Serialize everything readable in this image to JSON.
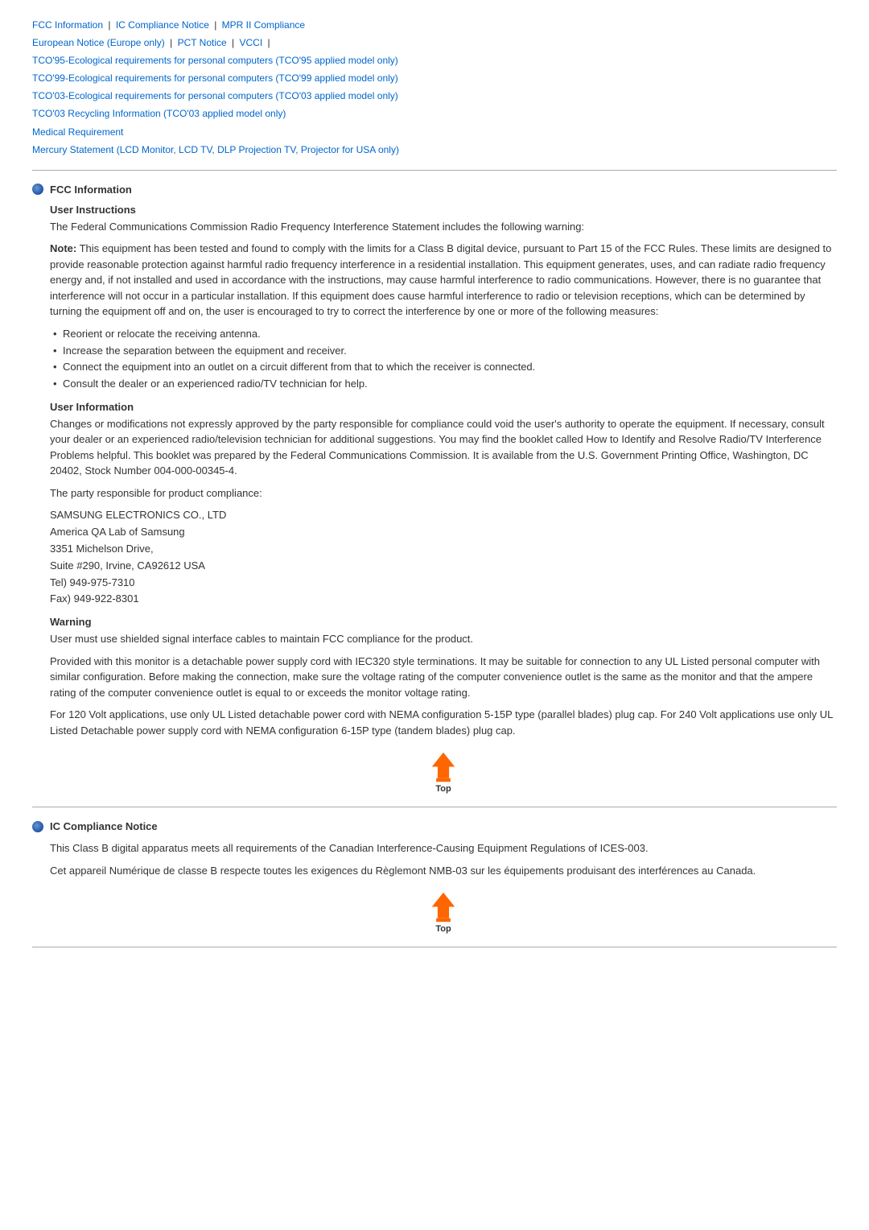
{
  "nav": {
    "links": [
      {
        "label": "FCC Information",
        "id": "fcc"
      },
      {
        "label": "IC Compliance Notice",
        "id": "ic"
      },
      {
        "label": "MPR II Compliance",
        "id": "mpr"
      },
      {
        "label": "European Notice (Europe only)",
        "id": "eu"
      },
      {
        "label": "PCT Notice",
        "id": "pct"
      },
      {
        "label": "VCCI",
        "id": "vcci"
      },
      {
        "label": "TCO'95-Ecological requirements for personal computers (TCO'95 applied model only)",
        "id": "tco95"
      },
      {
        "label": "TCO'99-Ecological requirements for personal computers (TCO'99 applied model only)",
        "id": "tco99"
      },
      {
        "label": "TCO'03-Ecological requirements for personal computers (TCO'03 applied model only)",
        "id": "tco03"
      },
      {
        "label": "TCO'03 Recycling Information (TCO'03 applied model only)",
        "id": "tco03r"
      },
      {
        "label": "Medical Requirement",
        "id": "medical"
      },
      {
        "label": "Mercury Statement (LCD Monitor, LCD TV, DLP Projection TV, Projector for USA only)",
        "id": "mercury"
      }
    ]
  },
  "sections": {
    "fcc": {
      "title": "FCC Information",
      "user_instructions_heading": "User Instructions",
      "user_instructions_intro": "The Federal Communications Commission Radio Frequency Interference Statement includes the following warning:",
      "note_bold": "Note:",
      "note_text": " This equipment has been tested and found to comply with the limits for a Class B digital device, pursuant to Part 15 of the FCC Rules. These limits are designed to provide reasonable protection against harmful radio frequency interference in a residential installation. This equipment generates, uses, and can radiate radio frequency energy and, if not installed and used in accordance with the instructions, may cause harmful interference to radio communications. However, there is no guarantee that interference will not occur in a particular installation. If this equipment does cause harmful interference to radio or television receptions, which can be determined by turning the equipment off and on, the user is encouraged to try to correct the interference by one or more of the following measures:",
      "bullet_items": [
        "Reorient or relocate the receiving antenna.",
        "Increase the separation between the equipment and receiver.",
        "Connect the equipment into an outlet on a circuit different from that to which the receiver is connected.",
        "Consult the dealer or an experienced radio/TV technician for help."
      ],
      "user_info_heading": "User Information",
      "user_info_text": "Changes or modifications not expressly approved by the party responsible for compliance could void the user's authority to operate the equipment. If necessary, consult your dealer or an experienced radio/television technician for additional suggestions. You may find the booklet called How to Identify and Resolve Radio/TV Interference Problems helpful. This booklet was prepared by the Federal Communications Commission. It is available from the U.S. Government Printing Office, Washington, DC 20402, Stock Number 004-000-00345-4.",
      "party_intro": "The party responsible for product compliance:",
      "address_lines": [
        "SAMSUNG ELECTRONICS CO., LTD",
        "America QA Lab of Samsung",
        "3351 Michelson Drive,",
        "Suite #290, Irvine, CA92612 USA",
        "Tel) 949-975-7310",
        "Fax) 949-922-8301"
      ],
      "warning_heading": "Warning",
      "warning_text1": "User must use shielded signal interface cables to maintain FCC compliance for the product.",
      "warning_text2": "Provided with this monitor is a detachable power supply cord with IEC320 style terminations. It may be suitable for connection to any UL Listed personal computer with similar configuration. Before making the connection, make sure the voltage rating of the computer convenience outlet is the same as the monitor and that the ampere rating of the computer convenience outlet is equal to or exceeds the monitor voltage rating.",
      "warning_text3": "For 120 Volt applications, use only UL Listed detachable power cord with NEMA configuration 5-15P type (parallel blades) plug cap. For 240 Volt applications use only UL Listed Detachable power supply cord with NEMA configuration 6-15P type (tandem blades) plug cap."
    },
    "ic": {
      "title": "IC Compliance Notice",
      "text1": "This Class B digital apparatus meets all requirements of the Canadian Interference-Causing Equipment Regulations of ICES-003.",
      "text2": "Cet appareil Numérique de classe B respecte toutes les exigences du Règlemont NMB-03 sur les équipements produisant des interférences au Canada."
    }
  },
  "top_button_label": "Top"
}
